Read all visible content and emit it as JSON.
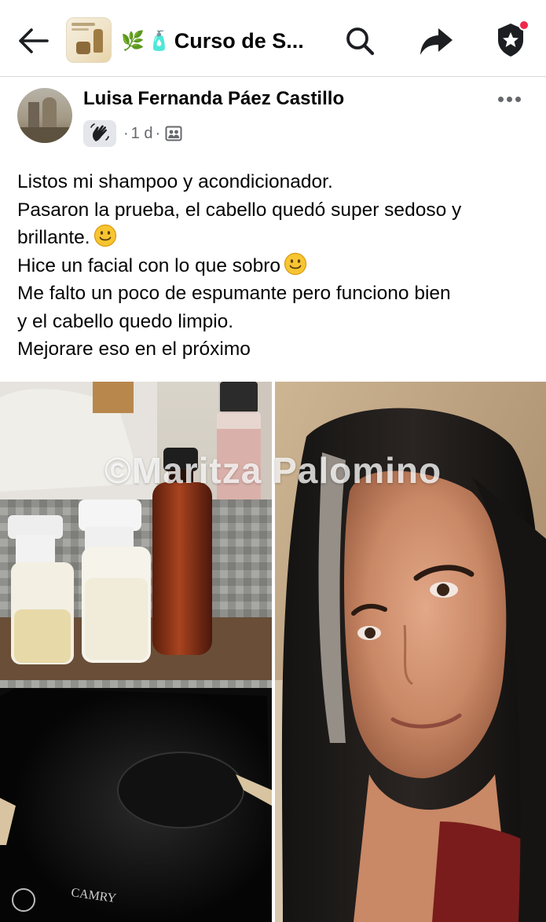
{
  "header": {
    "group_title": "Curso de S...",
    "title_emojis": [
      "🌿",
      "🧴"
    ],
    "icons": [
      "back-arrow-icon",
      "search-icon",
      "share-icon",
      "admin-badge-icon"
    ],
    "notification_dot_color": "#f0284a"
  },
  "post": {
    "author": "Luisa Fernanda Páez Castillo",
    "member_badge_icon": "waving-hand-icon",
    "separator": "·",
    "time": "1 d",
    "audience_icon": "group-members-icon",
    "text_lines": [
      "Listos mi shampoo y acondicionador.",
      "Pasaron la prueba, el cabello quedó super sedoso y",
      "brillante.",
      "Hice un facial con lo que sobro",
      "Me falto un poco de espumante pero funciono bien",
      "y el cabello quedo limpio.",
      "Mejorare eso en el próximo"
    ],
    "photos": [
      {
        "description_icon": "product-bottles-photo",
        "scale_brand": "CAMRY"
      },
      {
        "description_icon": "portrait-photo"
      }
    ],
    "watermark": "©Maritza Palomino"
  },
  "colors": {
    "text_primary": "#050505",
    "text_secondary": "#65676b",
    "icon_dark": "#1c1e21",
    "badge_bg": "#e4e6eb"
  }
}
